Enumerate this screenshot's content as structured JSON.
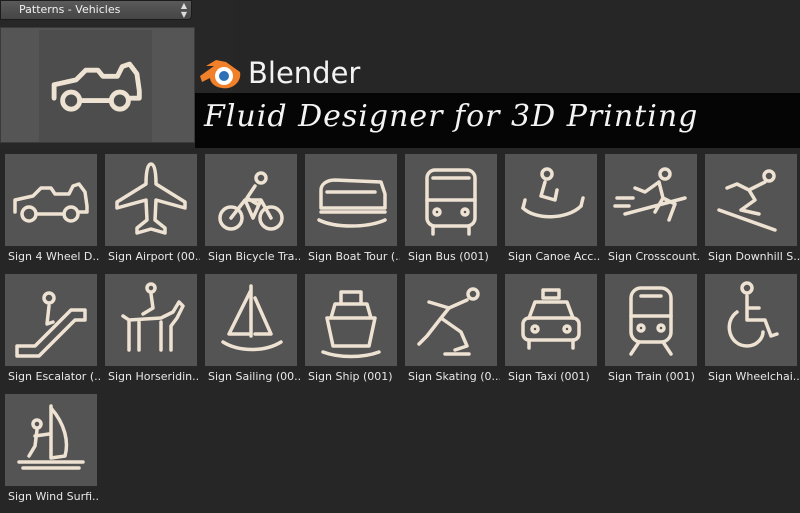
{
  "dropdown": {
    "label": "Patterns - Vehicles"
  },
  "logo": {
    "text": "Blender"
  },
  "banner": {
    "title": "Fluid Designer for 3D Printing"
  },
  "items": [
    {
      "label": "Sign 4 Wheel D...",
      "icon": "jeep-icon"
    },
    {
      "label": "Sign Airport (00...",
      "icon": "airplane-icon"
    },
    {
      "label": "Sign Bicycle Tra...",
      "icon": "bicycle-icon"
    },
    {
      "label": "Sign Boat Tour (...",
      "icon": "tour-boat-icon"
    },
    {
      "label": "Sign Bus (001)",
      "icon": "bus-icon"
    },
    {
      "label": "Sign Canoe Acc...",
      "icon": "canoe-icon"
    },
    {
      "label": "Sign Crosscount...",
      "icon": "cross-country-ski-icon"
    },
    {
      "label": "Sign Downhill S...",
      "icon": "downhill-ski-icon"
    },
    {
      "label": "Sign Escalator (...",
      "icon": "escalator-icon"
    },
    {
      "label": "Sign Horseridin...",
      "icon": "horse-riding-icon"
    },
    {
      "label": "Sign Sailing (00...",
      "icon": "sailboat-icon"
    },
    {
      "label": "Sign Ship (001)",
      "icon": "ship-icon"
    },
    {
      "label": "Sign Skating (0...",
      "icon": "skating-icon"
    },
    {
      "label": "Sign Taxi (001)",
      "icon": "taxi-icon"
    },
    {
      "label": "Sign Train (001)",
      "icon": "train-icon"
    },
    {
      "label": "Sign Wheelchai...",
      "icon": "wheelchair-icon"
    },
    {
      "label": "Sign Wind Surfi...",
      "icon": "windsurf-icon"
    }
  ]
}
